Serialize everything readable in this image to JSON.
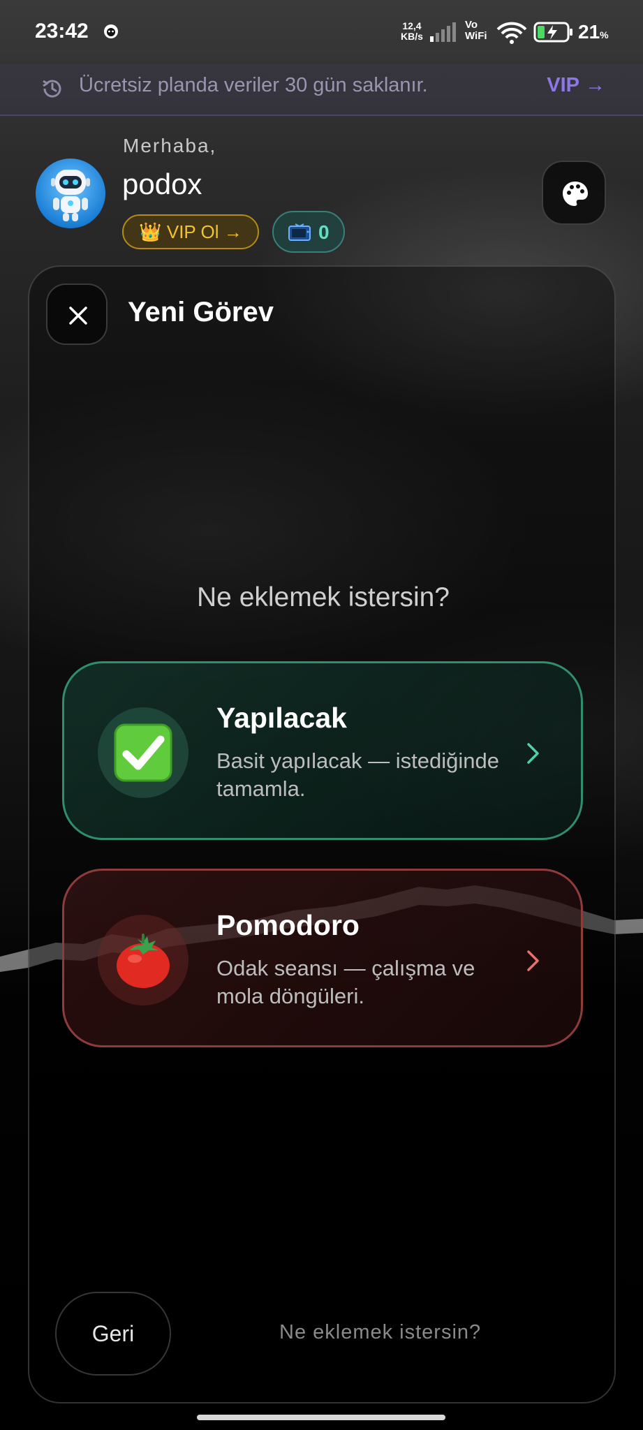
{
  "status_bar": {
    "time": "23:42",
    "net_speed_value": "12,4",
    "net_speed_unit": "KB/s",
    "vowifi_line1": "Vo",
    "vowifi_line2": "WiFi",
    "battery_level": "21",
    "battery_unit": "%"
  },
  "banner": {
    "icon": "history-icon",
    "text": "Ücretsiz planda veriler 30 gün saklanır.",
    "vip_label": "VIP",
    "vip_arrow": "→"
  },
  "header": {
    "greeting": "Merhaba,",
    "username": "podox",
    "vip_badge_icon": "👑",
    "vip_badge_label": "VIP Ol →",
    "tv_icon": "📺",
    "tv_count": "0",
    "palette_icon": "palette-icon"
  },
  "modal": {
    "title": "Yeni Görev",
    "question": "Ne eklemek istersin?",
    "options": [
      {
        "icon": "check-mark-icon",
        "title": "Yapılacak",
        "description": "Basit yapılacak — istediğinde tamamla.",
        "accent": "#2f8e6c"
      },
      {
        "icon": "tomato-icon",
        "title": "Pomodoro",
        "description": "Odak seansı — çalışma ve mola döngüleri.",
        "accent": "#8e3b3b"
      }
    ],
    "back_label": "Geri",
    "footer_hint": "Ne eklemek istersin?"
  },
  "colors": {
    "vip_purple": "#8c78e6",
    "gold": "#f2c230",
    "teal": "#5de0c3",
    "todo_green": "#2f8e6c",
    "pomodoro_red": "#8e3b3b"
  }
}
